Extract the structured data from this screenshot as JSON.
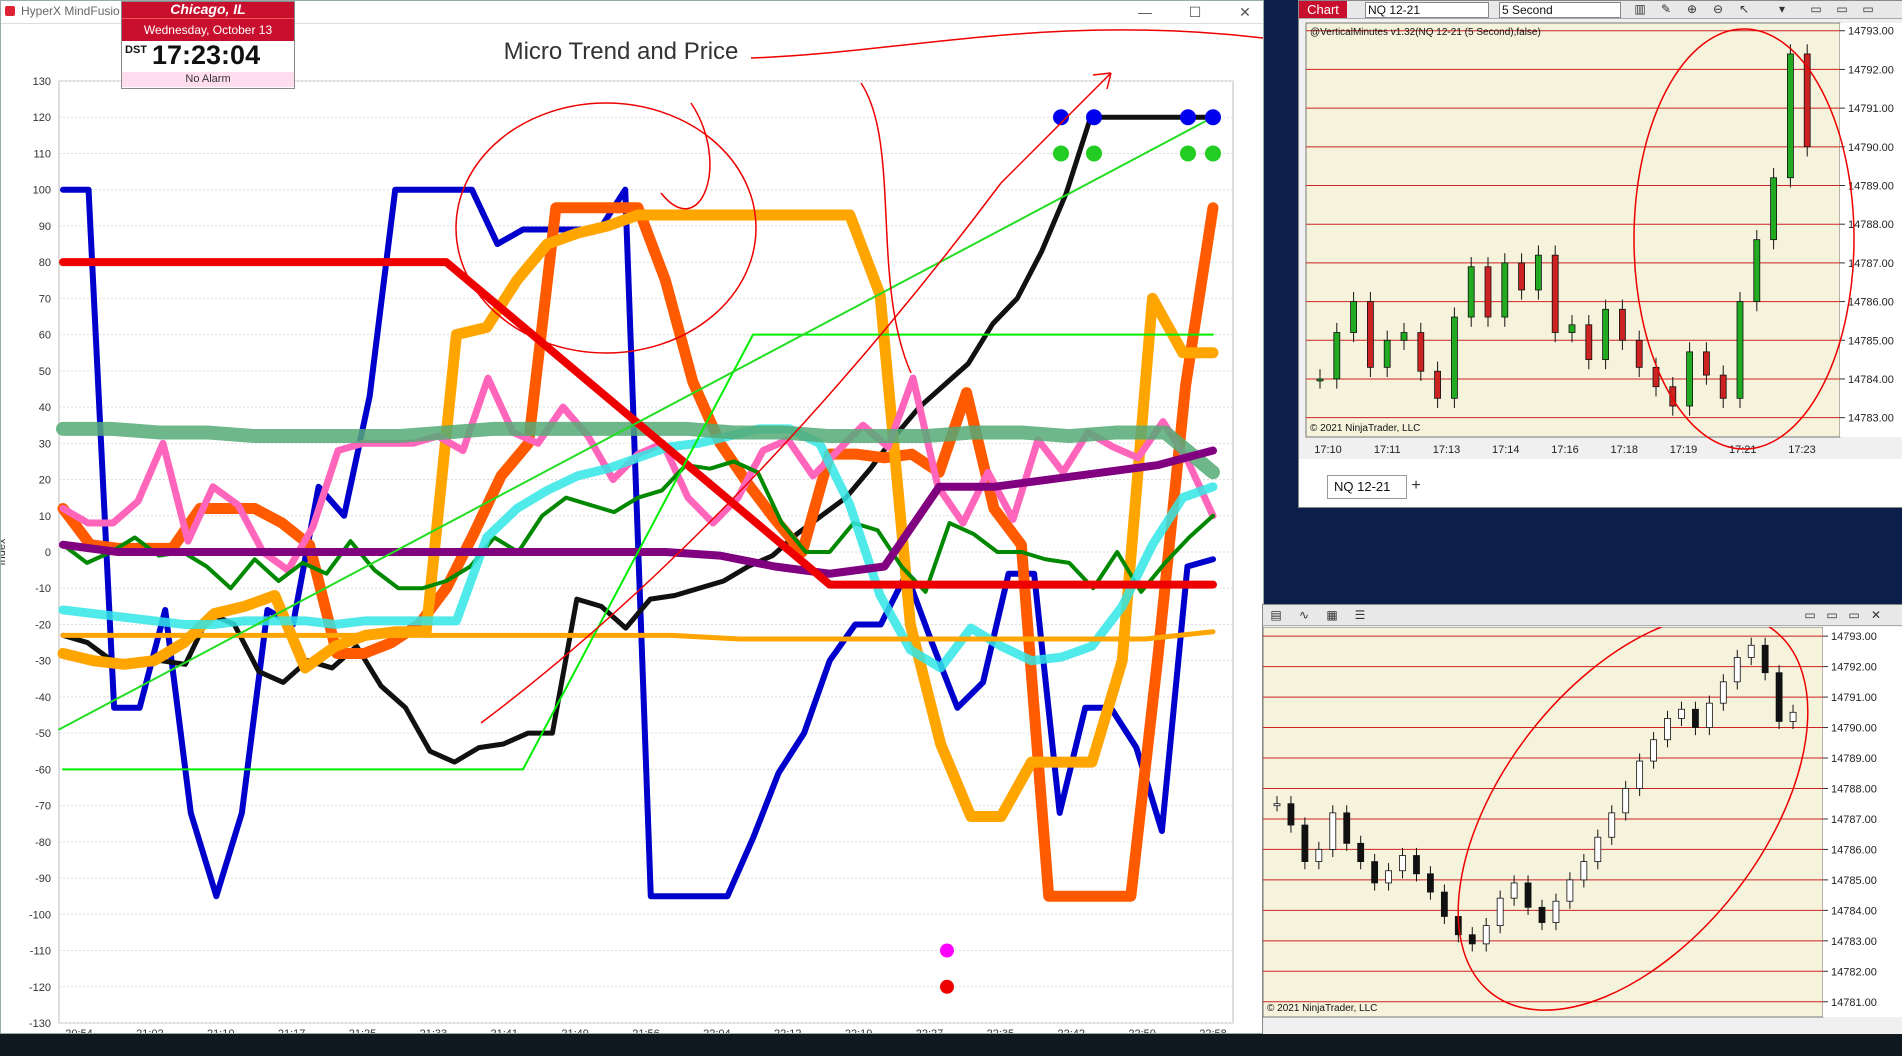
{
  "main_window": {
    "app_title": "HyperX MindFusio",
    "clock": {
      "city": "Chicago, IL",
      "date": "Wednesday, October 13",
      "dst": "DST",
      "time": "17:23:04",
      "alarm": "No Alarm"
    },
    "window_buttons": {
      "minimize": "—",
      "maximize": "☐",
      "close": "✕"
    }
  },
  "chart_data": [
    {
      "type": "line",
      "title": "Micro Trend and Price",
      "ylabel": "Index",
      "ylim": [
        -130,
        130
      ],
      "yticks": [
        130,
        120,
        110,
        100,
        90,
        80,
        70,
        60,
        50,
        40,
        30,
        20,
        10,
        0,
        -10,
        -20,
        -30,
        -40,
        -50,
        -60,
        -70,
        -80,
        -90,
        -100,
        -110,
        -120,
        -130
      ],
      "xticks": [
        "20:54",
        "21:02",
        "21:10",
        "21:17",
        "21:25",
        "21:33",
        "21:41",
        "21:49",
        "21:56",
        "22:04",
        "22:12",
        "22:19",
        "22:27",
        "22:35",
        "22:42",
        "22:50",
        "22:58"
      ],
      "grid": true,
      "series": [
        {
          "color": "#0000cc",
          "values": [
            100,
            100,
            -43,
            -43,
            -16,
            -72,
            -95,
            -72,
            -16,
            -20,
            18,
            10,
            43,
            100,
            100,
            100,
            100,
            85,
            89,
            89,
            89,
            89,
            100,
            -95,
            -95,
            -95,
            -95,
            -79,
            -61,
            -50,
            -30,
            -20,
            -20,
            -6,
            -25,
            -43,
            -36,
            -6,
            -6,
            -72,
            -43,
            -43,
            -54,
            -77,
            -4,
            -2
          ]
        },
        {
          "color": "#111111",
          "values": [
            -23,
            -25,
            -30,
            -31,
            -30,
            -31,
            -17,
            -20,
            -33,
            -36,
            -30,
            -32,
            -26,
            -37,
            -43,
            -55,
            -58,
            -54,
            -53,
            -50,
            -50,
            -13,
            -15,
            -21,
            -13,
            -12,
            -10,
            -8,
            -4,
            -1,
            5,
            10,
            15,
            23,
            32,
            40,
            46,
            52,
            63,
            70,
            83,
            99,
            120,
            120,
            120,
            120,
            120,
            120
          ]
        },
        {
          "color": "#ff5a00",
          "values": [
            12,
            2,
            1,
            1,
            1,
            12,
            12,
            12,
            8,
            2,
            -28,
            -28,
            -25,
            -20,
            -10,
            5,
            21,
            30,
            95,
            95,
            95,
            95,
            75,
            47,
            30,
            19,
            9,
            0,
            27,
            27,
            26,
            27,
            22,
            44,
            12,
            2,
            -95,
            -95,
            -95,
            -95,
            -28,
            46,
            95
          ]
        },
        {
          "color": "#ffa500",
          "values": [
            -28,
            -30,
            -31,
            -30,
            -25,
            -17,
            -15,
            -12,
            -32,
            -26,
            -23,
            -22,
            -22,
            60,
            62,
            75,
            85,
            88,
            90,
            93,
            93,
            93,
            93,
            93,
            93,
            93,
            93,
            71,
            -20,
            -53,
            -73,
            -73,
            -58,
            -58,
            -58,
            -30,
            70,
            55,
            55
          ]
        },
        {
          "color": "#ff66bb",
          "values": [
            12,
            8,
            8,
            14,
            30,
            3,
            18,
            13,
            0,
            -5,
            7,
            28,
            30,
            30,
            30,
            32,
            28,
            48,
            33,
            30,
            40,
            32,
            20,
            27,
            30,
            15,
            8,
            15,
            28,
            31,
            21,
            28,
            35,
            29,
            48,
            18,
            8,
            22,
            9,
            31,
            22,
            33,
            29,
            26,
            36,
            25,
            10
          ]
        },
        {
          "color": "#008800",
          "values": [
            2,
            -3,
            0,
            4,
            -1,
            0,
            -4,
            -10,
            -2,
            -8,
            -3,
            -6,
            3,
            -5,
            -10,
            -10,
            -8,
            -4,
            4,
            0,
            10,
            15,
            13,
            11,
            15,
            17,
            24,
            23,
            25,
            22,
            8,
            0,
            0,
            8,
            6,
            -4,
            -11,
            8,
            5,
            0,
            0,
            -2,
            -3,
            -10,
            0,
            -11,
            -3,
            4,
            10
          ]
        },
        {
          "color": "#33e6e6",
          "values": [
            -16,
            -17,
            -18,
            -19,
            -20,
            -20,
            -19,
            -19,
            -19,
            -20,
            -19,
            -19,
            -19,
            -19,
            4,
            12,
            17,
            21,
            23,
            26,
            29,
            30,
            32,
            34,
            34,
            30,
            13,
            -12,
            -27,
            -32,
            -21,
            -26,
            -30,
            -29,
            -26,
            -15,
            2,
            15,
            18
          ]
        },
        {
          "color": "#55aa77",
          "values": [
            34,
            34,
            33,
            33,
            32,
            32,
            32,
            32,
            33,
            34,
            34,
            34,
            34,
            34,
            33,
            33,
            32,
            32,
            32,
            33,
            33,
            32,
            33,
            33,
            22
          ]
        },
        {
          "color": "#800080",
          "values": [
            2,
            0,
            0,
            0,
            0,
            0,
            0,
            0,
            0,
            0,
            0,
            0,
            -1,
            -4,
            -6,
            -4,
            18,
            18,
            20,
            22,
            24,
            28
          ]
        },
        {
          "color": "#ee0000",
          "values": [
            80,
            80,
            -9,
            -9
          ]
        },
        {
          "color": "#ffa500",
          "values": [
            -23,
            -23,
            -23,
            -23,
            -23,
            -23,
            -23,
            -23,
            -23,
            -23,
            -24,
            -24,
            -24,
            -24,
            -24,
            -24,
            -24,
            -22
          ]
        },
        {
          "color": "#00ee00",
          "values": [
            -60,
            -60,
            -60,
            60,
            60,
            60
          ]
        },
        {
          "color": "#22dd22",
          "values": [
            -49,
            120
          ]
        }
      ],
      "markers": [
        {
          "color": "#0000ee",
          "y": 120
        },
        {
          "color": "#22cc22",
          "y": 110
        },
        {
          "color": "#ff00ff",
          "y": -110
        },
        {
          "color": "#ee0000",
          "y": -120
        }
      ]
    },
    {
      "type": "candlestick",
      "title": "@VerticalMinutes v1.32(NQ 12-21 (5 Second),false)",
      "copyright": "© 2021 NinjaTrader, LLC",
      "ylim": [
        14782.5,
        14793.2
      ],
      "yticks": [
        "14793.00",
        "14792.00",
        "14791.00",
        "14790.00",
        "14789.00",
        "14788.00",
        "14787.00",
        "14786.00",
        "14785.00",
        "14784.00",
        "14783.00"
      ],
      "xticks": [
        "17:10",
        "17:11",
        "17:13",
        "17:14",
        "17:16",
        "17:18",
        "17:19",
        "17:21",
        "17:23"
      ],
      "closes": [
        14784.0,
        14785.2,
        14786.0,
        14784.3,
        14785.0,
        14785.2,
        14784.2,
        14783.5,
        14785.6,
        14786.9,
        14785.6,
        14787.0,
        14786.3,
        14787.2,
        14785.2,
        14785.4,
        14784.5,
        14785.8,
        14785.0,
        14784.3,
        14783.8,
        14783.3,
        14784.7,
        14784.1,
        14783.5,
        14786.0,
        14787.6,
        14789.2,
        14792.4,
        14790.0
      ],
      "up_color": "#22aa22",
      "down_color": "#cc2222",
      "grid_color": "#cc2222"
    },
    {
      "type": "candlestick",
      "ylim": [
        14780.5,
        14793.3
      ],
      "yticks": [
        "14793.00",
        "14792.00",
        "14791.00",
        "14790.00",
        "14789.00",
        "14788.00",
        "14787.00",
        "14786.00",
        "14785.00",
        "14784.00",
        "14783.00",
        "14782.00",
        "14781.00"
      ],
      "closes": [
        14787.5,
        14786.8,
        14785.6,
        14786.0,
        14787.2,
        14786.2,
        14785.6,
        14784.9,
        14785.3,
        14785.8,
        14785.2,
        14784.6,
        14783.8,
        14783.2,
        14782.9,
        14783.5,
        14784.4,
        14784.9,
        14784.1,
        14783.6,
        14784.3,
        14785.0,
        14785.6,
        14786.4,
        14787.2,
        14788.0,
        14788.9,
        14789.6,
        14790.3,
        14790.6,
        14790.0,
        14790.8,
        14791.5,
        14792.3,
        14792.7,
        14791.8,
        14790.2,
        14790.5
      ],
      "grid_color": "#cc2222",
      "copyright": "© 2021 NinjaTrader, LLC"
    }
  ],
  "nt_top": {
    "tab_label": "Chart",
    "instrument": "NQ 12-21",
    "interval": "5 Second",
    "instrument_tab": "NQ 12-21",
    "add_tab": "+"
  }
}
